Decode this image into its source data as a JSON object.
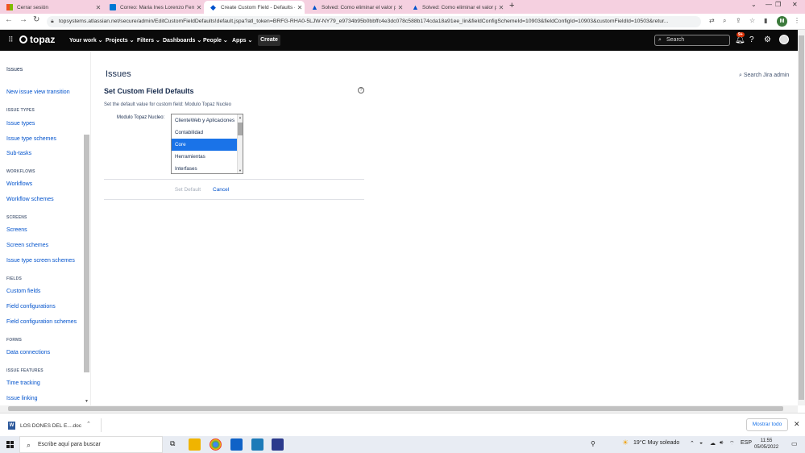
{
  "browser": {
    "tabs": [
      {
        "label": "Cerrar sesión",
        "active": false
      },
      {
        "label": "Correo: Maria Ines Lorenzo Ferna",
        "active": false
      },
      {
        "label": "Create Custom Field - Defaults -",
        "active": true
      },
      {
        "label": "Solved: Como eliminar el valor p",
        "active": false
      },
      {
        "label": "Solved: Como eliminar el valor p",
        "active": false
      }
    ],
    "url": "topsystems.atlassian.net/secure/admin/EditCustomFieldDefaults!default.jspa?atl_token=BRFG-RHA0-5LJW-NY79_e9734b95b0bbffc4e3dc078c588b174cda18a91ee_lin&fieldConfigSchemeId=10903&fieldConfigId=10903&customFieldId=10503&retur...",
    "profile_initial": "M"
  },
  "jira_nav": {
    "logo_text": "topaz",
    "items": [
      "Your work",
      "Projects",
      "Filters",
      "Dashboards",
      "People",
      "Apps"
    ],
    "create_label": "Create",
    "search_placeholder": "Search",
    "notifications_badge": "9+"
  },
  "sidebar": {
    "title": "Issues",
    "top_link": "New issue view transition",
    "sections": [
      {
        "heading": "ISSUE TYPES",
        "links": [
          "Issue types",
          "Issue type schemes",
          "Sub-tasks"
        ]
      },
      {
        "heading": "WORKFLOWS",
        "links": [
          "Workflows",
          "Workflow schemes"
        ]
      },
      {
        "heading": "SCREENS",
        "links": [
          "Screens",
          "Screen schemes",
          "Issue type screen schemes"
        ]
      },
      {
        "heading": "FIELDS",
        "links": [
          "Custom fields",
          "Field configurations",
          "Field configuration schemes"
        ]
      },
      {
        "heading": "FORMS",
        "links": [
          "Data connections"
        ]
      },
      {
        "heading": "ISSUE FEATURES",
        "links": [
          "Time tracking",
          "Issue linking"
        ]
      }
    ]
  },
  "main": {
    "page_title": "Issues",
    "admin_search": "Search Jira admin",
    "section_title": "Set Custom Field Defaults",
    "description": "Set the default value for custom field: Modulo Topaz Nucleo",
    "field_label": "Modulo Topaz Nucleo:",
    "options": [
      "ClienteWeb y Aplicaciones",
      "Contabilidad",
      "Core",
      "Herramientas",
      "Interfases"
    ],
    "selected_option": "Core",
    "set_default_label": "Set Default",
    "cancel_label": "Cancel"
  },
  "downloads": {
    "file_name": "LOS DONES DEL E....doc",
    "show_all_label": "Mostrar todo"
  },
  "taskbar": {
    "search_placeholder": "Escribe aquí para buscar",
    "weather": "19°C  Muy soleado",
    "language": "ESP",
    "time": "11:55",
    "date": "05/05/2022"
  }
}
